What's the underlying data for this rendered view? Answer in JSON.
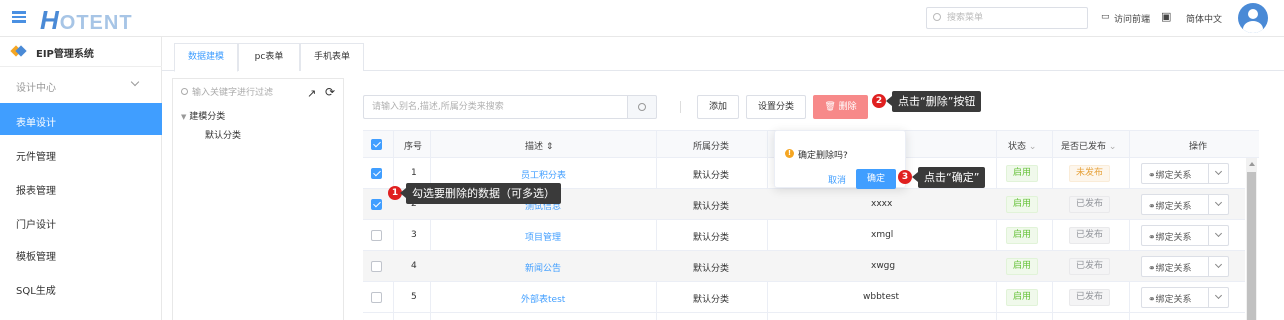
{
  "header": {
    "logo_big": "H",
    "logo_rest": "OTENT",
    "search_placeholder": "搜索菜单",
    "visit_frontend": "访问前端",
    "language": "简体中文"
  },
  "sidebar": {
    "system_title": "EIP管理系统",
    "group_label": "设计中心",
    "items": [
      {
        "label": "表单设计",
        "active": true
      },
      {
        "label": "元件管理"
      },
      {
        "label": "报表管理"
      },
      {
        "label": "门户设计"
      },
      {
        "label": "模板管理"
      },
      {
        "label": "SQL生成"
      }
    ]
  },
  "tabs": [
    "数据建模",
    "pc表单",
    "手机表单"
  ],
  "tree": {
    "search_placeholder": "输入关键字进行过滤",
    "root": "建模分类",
    "child": "默认分类"
  },
  "toolbar": {
    "search_placeholder": "请输入别名,描述,所属分类来搜索",
    "add": "添加",
    "set_category": "设置分类",
    "delete": "删除"
  },
  "table": {
    "headers": [
      "序号",
      "描述",
      "所属分类",
      "状态",
      "是否已发布",
      "操作"
    ],
    "rows": [
      {
        "no": "1",
        "desc": "员工积分表",
        "category": "默认分类",
        "alias": "",
        "status": "启用",
        "published": "未发布",
        "op": "绑定关系",
        "checked": true
      },
      {
        "no": "2",
        "desc": "测试信息",
        "category": "默认分类",
        "alias": "xxxx",
        "status": "启用",
        "published": "已发布",
        "op": "绑定关系",
        "checked": true
      },
      {
        "no": "3",
        "desc": "项目管理",
        "category": "默认分类",
        "alias": "xmgl",
        "status": "启用",
        "published": "已发布",
        "op": "绑定关系",
        "checked": false
      },
      {
        "no": "4",
        "desc": "新闻公告",
        "category": "默认分类",
        "alias": "xwgg",
        "status": "启用",
        "published": "已发布",
        "op": "绑定关系",
        "checked": false
      },
      {
        "no": "5",
        "desc": "外部表test",
        "category": "默认分类",
        "alias": "wbbtest",
        "status": "启用",
        "published": "已发布",
        "op": "绑定关系",
        "checked": false
      }
    ]
  },
  "popover": {
    "question": "确定删除吗?",
    "cancel": "取消",
    "confirm": "确定"
  },
  "annotations": [
    {
      "n": "1",
      "text": "勾选要删除的数据（可多选）"
    },
    {
      "n": "2",
      "text": "点击“删除”按钮"
    },
    {
      "n": "3",
      "text": "点击“确定”"
    }
  ],
  "colors": {
    "primary": "#409eff",
    "danger": "#f78989",
    "success": "#67c23a",
    "warning": "#e6a23c"
  }
}
